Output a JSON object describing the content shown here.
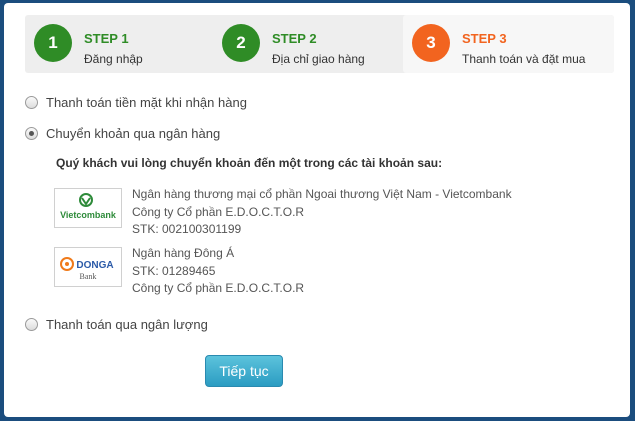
{
  "steps": [
    {
      "number": "1",
      "title": "STEP 1",
      "desc": "Đăng nhập"
    },
    {
      "number": "2",
      "title": "STEP 2",
      "desc": "Địa chỉ giao hàng"
    },
    {
      "number": "3",
      "title": "STEP 3",
      "desc": "Thanh toán và đặt mua"
    }
  ],
  "payment": {
    "cash": "Thanh toán tiền mặt khi nhận hàng",
    "bank": "Chuyển khoản qua ngân hàng",
    "nganluong": "Thanh toán qua ngân lượng",
    "note": "Quý khách vui lòng chuyển khoản đến một trong các tài khoản sau:"
  },
  "banks": [
    {
      "logo_text": "Vietcombank",
      "lines": [
        "Ngân hàng thương mại cổ phần Ngoai thương Việt Nam - Vietcombank",
        "Công ty Cổ phần E.D.O.C.T.O.R",
        "STK: 002100301199"
      ]
    },
    {
      "logo_text": "DONGA",
      "logo_sub": "Bank",
      "lines": [
        "Ngân hàng Đông Á",
        "STK: 01289465",
        "Công ty Cổ phần E.D.O.C.T.O.R"
      ]
    }
  ],
  "button": {
    "label": "Tiếp tục"
  },
  "colors": {
    "step_done": "#2f8c26",
    "step_active": "#f2641f",
    "button": "#3aa8cc",
    "background": "#1b4d7e"
  }
}
